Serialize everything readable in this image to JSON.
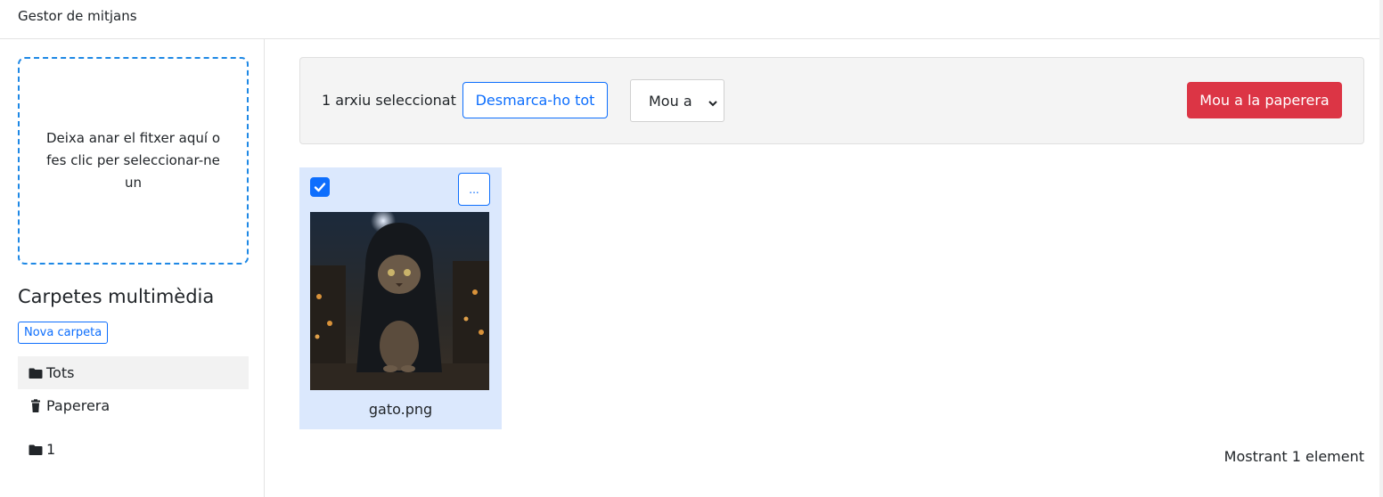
{
  "header": {
    "title": "Gestor de mitjans"
  },
  "sidebar": {
    "dropzone_text": "Deixa anar el fitxer aquí o fes clic per seleccionar-ne un",
    "folders_title": "Carpetes multimèdia",
    "new_folder_label": "Nova carpeta",
    "items": [
      {
        "label": "Tots",
        "icon": "folder-icon",
        "active": true
      },
      {
        "label": "Paperera",
        "icon": "trash-icon",
        "active": false
      },
      {
        "label": "1",
        "icon": "folder-icon",
        "active": false
      }
    ]
  },
  "toolbar": {
    "selection_text": "1 arxiu seleccionat",
    "deselect_label": "Desmarca-ho tot",
    "move_to_value": "Mou a",
    "trash_label": "Mou a la paperera"
  },
  "files": [
    {
      "name": "gato.png",
      "selected": true,
      "menu_label": "..."
    }
  ],
  "footer": {
    "count_text": "Mostrant 1 element"
  },
  "colors": {
    "primary": "#0d6efd",
    "danger": "#dc3545",
    "selected_card": "#dbe8fd",
    "dropzone_border": "#1e88e5"
  }
}
